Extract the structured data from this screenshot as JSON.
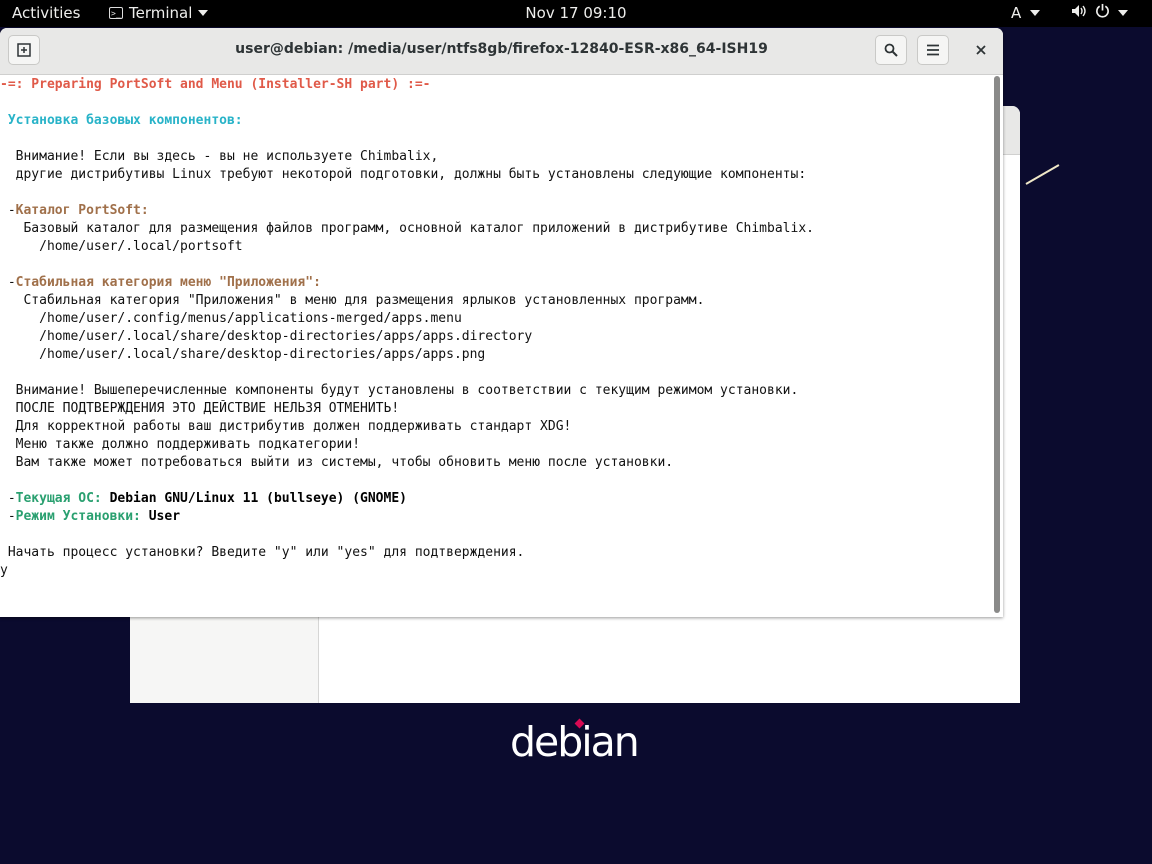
{
  "topbar": {
    "activities": "Activities",
    "app_name": "Terminal",
    "clock": "Nov 17  09:10",
    "keyboard_layout": "A"
  },
  "terminal": {
    "title": "user@debian: /media/user/ntfs8gb/firefox-12840-ESR-x86_64-ISH19",
    "lines": {
      "l1": "-=: Preparing PortSoft and Menu (Installer-SH part) :=-",
      "l3": " Установка базовых компонентов:",
      "l5": "  Внимание! Если вы здесь - вы не используете Chimbalix,",
      "l6": "  другие дистрибутивы Linux требуют некоторой подготовки, должны быть установлены следующие компоненты:",
      "l8_dash": " -",
      "l8_head": "Каталог PortSoft:",
      "l9": "   Базовый каталог для размещения файлов программ, основной каталог приложений в дистрибутиве Chimbalix.",
      "l10": "     /home/user/.local/portsoft",
      "l12_dash": " -",
      "l12_head": "Стабильная категория меню \"Приложения\":",
      "l13": "   Стабильная категория \"Приложения\" в меню для размещения ярлыков установленных программ.",
      "l14": "     /home/user/.config/menus/applications-merged/apps.menu",
      "l15": "     /home/user/.local/share/desktop-directories/apps/apps.directory",
      "l16": "     /home/user/.local/share/desktop-directories/apps/apps.png",
      "l18": "  Внимание! Вышеперечисленные компоненты будут установлены в соответствии с текущим режимом установки.",
      "l19": "  ПОСЛЕ ПОДТВЕРЖДЕНИЯ ЭТО ДЕЙСТВИЕ НЕЛЬЗЯ ОТМЕНИТЬ!",
      "l20": "  Для корректной работы ваш дистрибутив должен поддерживать стандарт XDG!",
      "l21": "  Меню также должно поддерживать подкатегории!",
      "l22": "  Вам также может потребоваться выйти из системы, чтобы обновить меню после установки.",
      "l24_dash": " -",
      "l24_head": "Текущая ОС: ",
      "l24_val": "Debian GNU/Linux 11 (bullseye) (GNOME)",
      "l25_dash": " -",
      "l25_head": "Режим Установки: ",
      "l25_val": "User",
      "l27": " Начать процесс установки? Введите \"y\" или \"yes\" для подтверждения.",
      "l28": "y"
    }
  },
  "desktop": {
    "logo_text": "debian"
  },
  "colors": {
    "heading_red": "#e05a49",
    "heading_cyan": "#28b3c8",
    "heading_brown": "#a0704a",
    "heading_green": "#2aa070",
    "desktop_bg": "#0b0b2e",
    "debian_red": "#d70a53"
  },
  "icons": [
    "terminal-icon",
    "dropdown-arrow-icon",
    "volume-icon",
    "power-icon",
    "new-tab-icon",
    "search-icon",
    "hamburger-menu-icon",
    "close-icon"
  ]
}
